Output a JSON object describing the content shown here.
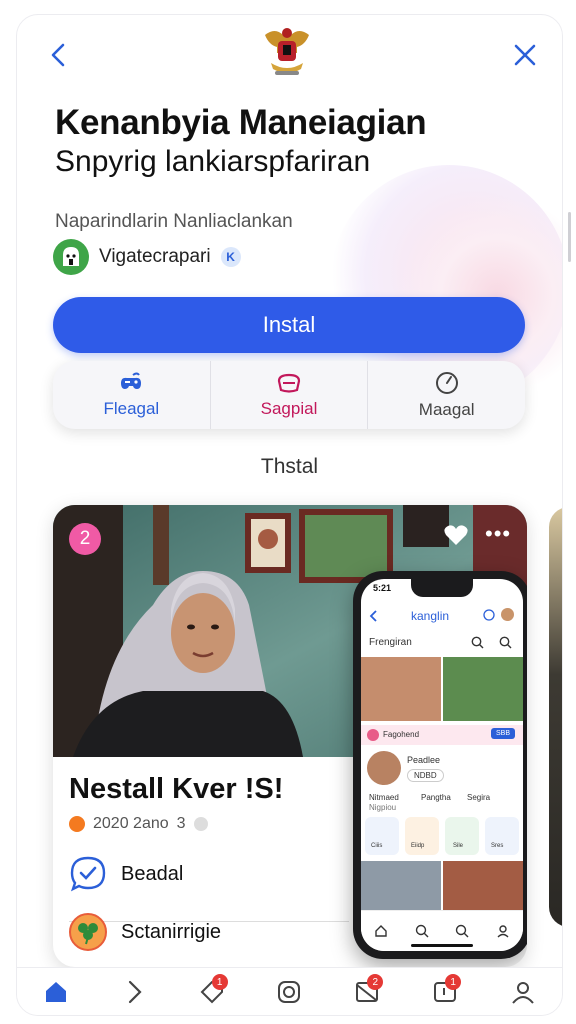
{
  "header": {
    "title": "Kenanbyia Maneiagian",
    "subtitle": "Snpyrig lankiarspfariran",
    "meta": "Naparindlarin Nanliaclankan",
    "developer": "Vigatecrapari",
    "verified_glyph": "K"
  },
  "install_label": "Instal",
  "actions": [
    {
      "label": "Fleagal",
      "icon": "controller-icon",
      "color": "#2b5fd8"
    },
    {
      "label": "Sagpial",
      "icon": "helmet-icon",
      "color": "#c2185b"
    },
    {
      "label": "Maagal",
      "icon": "gauge-icon",
      "color": "#444444"
    }
  ],
  "section_label": "Thstal",
  "card": {
    "badge": "2",
    "title": "Nestall Kver !S!",
    "meta_year": "2020 2ano",
    "meta_count": "3",
    "items": [
      {
        "label": "Beadal",
        "icon": "chat-check-icon"
      },
      {
        "label": "Sctanirrigie",
        "icon": "clover-app-icon"
      }
    ]
  },
  "phone": {
    "time": "5:21",
    "app_title": "kanglin",
    "search": "Frengiran",
    "section": "Fagohend",
    "button": "SBB",
    "profile_name": "Peadlee",
    "profile_tag": "NDBD",
    "tabs": [
      "Nitmaed",
      "Pangtha",
      "Segira"
    ],
    "tab_sub": "Nigpiou",
    "tiles": [
      "Ciiis",
      "Eiidp",
      "Sile",
      "Sres"
    ]
  },
  "bottom_nav": [
    {
      "name": "home",
      "badge": ""
    },
    {
      "name": "next",
      "badge": ""
    },
    {
      "name": "tag",
      "badge": "1"
    },
    {
      "name": "instagram",
      "badge": ""
    },
    {
      "name": "mail",
      "badge": "2"
    },
    {
      "name": "notes",
      "badge": "1"
    },
    {
      "name": "profile",
      "badge": ""
    }
  ],
  "colors": {
    "accent": "#2f5be8",
    "badge_pink": "#f05aa5",
    "notif_red": "#e53935"
  }
}
